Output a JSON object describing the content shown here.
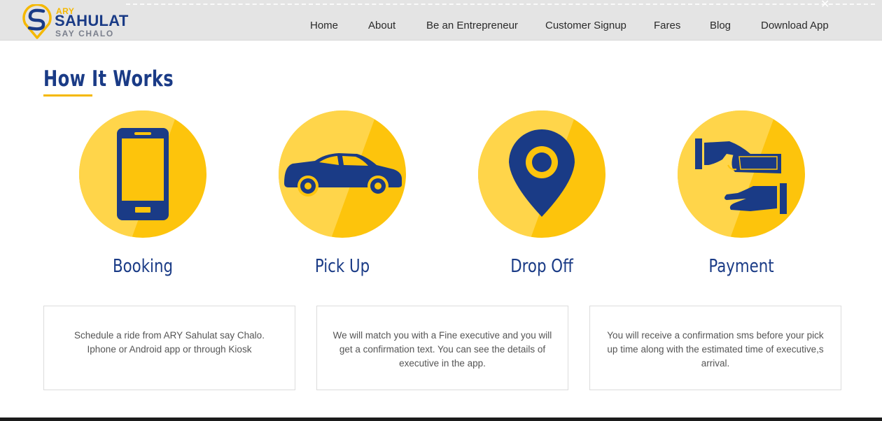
{
  "logo": {
    "line1": "ARY",
    "line2": "SAHULAT",
    "line3": "SAY CHALO"
  },
  "nav": [
    {
      "label": "Home"
    },
    {
      "label": "About"
    },
    {
      "label": "Be an Entrepreneur"
    },
    {
      "label": "Customer Signup"
    },
    {
      "label": "Fares"
    },
    {
      "label": "Blog"
    },
    {
      "label": "Download App"
    }
  ],
  "section": {
    "title": "How It Works"
  },
  "steps": [
    {
      "label": "Booking",
      "icon": "smartphone-icon"
    },
    {
      "label": "Pick Up",
      "icon": "car-icon"
    },
    {
      "label": "Drop Off",
      "icon": "location-pin-icon"
    },
    {
      "label": "Payment",
      "icon": "hand-payment-icon"
    }
  ],
  "cards": [
    {
      "text": "Schedule a ride from ARY Sahulat say Chalo. Iphone or Android app or through Kiosk"
    },
    {
      "text": "We will match you with a Fine executive and you will get a confirmation text. You can see the details of executive in the app."
    },
    {
      "text": "You will receive a confirmation sms before your pick up time along with the estimated time of executive,s arrival."
    }
  ],
  "colors": {
    "brand_blue": "#1a3b86",
    "brand_yellow": "#fdc40c",
    "header_bg": "#e4e4e4"
  }
}
